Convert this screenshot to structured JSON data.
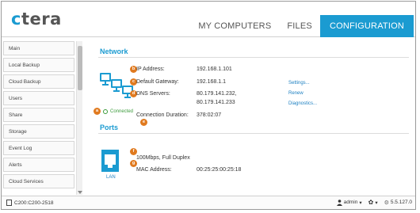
{
  "header": {
    "logo_text": "ctera",
    "logo_first_letter": "c",
    "logo_rest": "tera",
    "tabs": [
      {
        "label": "MY COMPUTERS",
        "active": false
      },
      {
        "label": "FILES",
        "active": false
      },
      {
        "label": "CONFIGURATION",
        "active": true
      }
    ]
  },
  "sidebar": {
    "items": [
      "Main",
      "Local Backup",
      "Cloud Backup",
      "Users",
      "Share",
      "Storage",
      "Event Log",
      "Alerts",
      "Cloud Services"
    ]
  },
  "network": {
    "title": "Network",
    "ip_label": "IP Address:",
    "ip_value": "192.168.1.101",
    "gateway_label": "Default Gateway:",
    "gateway_value": "192.168.1.1",
    "dns_label": "DNS Servers:",
    "dns_value_1": "80.179.141.232,",
    "dns_value_2": "80.179.141.233",
    "duration_label": "Connection Duration:",
    "duration_value": "378:02:07",
    "status_text": "Connected",
    "links": {
      "settings": "Settings...",
      "renew": "Renew",
      "diagnostics": "Diagnostics..."
    }
  },
  "ports": {
    "title": "Ports",
    "speed": "100Mbps, Full Duplex",
    "mac_label": "MAC Address:",
    "mac_value": "00:25:25:00:25:18",
    "lan_label": "LAN"
  },
  "callouts": {
    "a": "a",
    "b": "b",
    "c": "c",
    "d": "d",
    "e": "e",
    "f": "f",
    "g": "g"
  },
  "statusbar": {
    "device": "C200:C200-2518",
    "user": "admin",
    "version": "5.5.127.0"
  },
  "colors": {
    "accent": "#1b9bd1",
    "callout": "#e07a1f",
    "connected": "#3a9a3a",
    "link": "#1b7fc1"
  }
}
